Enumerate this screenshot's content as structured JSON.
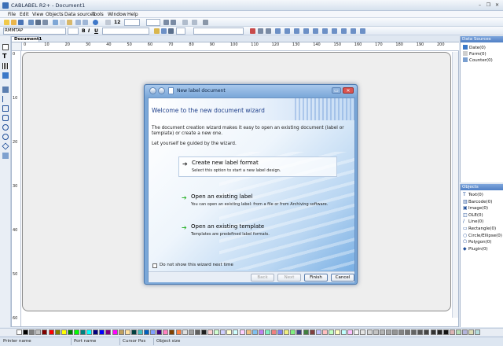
{
  "window": {
    "title": "CABLABEL R2+ - Document1",
    "controls": [
      "–",
      "❐",
      "✕"
    ]
  },
  "menu": [
    "File",
    "Edit",
    "View",
    "Objects",
    "Data sources",
    "Tools",
    "Window",
    "Help"
  ],
  "toolbar": {
    "font_combo": "RMMTAP",
    "size_combo": "12",
    "bold": "B",
    "italic": "I",
    "underline": "U"
  },
  "document": {
    "tab": "Document1"
  },
  "ruler_h": [
    "0",
    "10",
    "20",
    "30",
    "40",
    "50",
    "60",
    "70",
    "80",
    "90",
    "100",
    "110",
    "120",
    "130",
    "140",
    "150",
    "160",
    "170",
    "180",
    "190",
    "200"
  ],
  "ruler_v": [
    "0",
    "10",
    "20",
    "30",
    "40",
    "50",
    "60"
  ],
  "data_sources": {
    "title": "Data Sources",
    "items": [
      {
        "label": "Date(0)",
        "color": "#3a78c8"
      },
      {
        "label": "Form(0)",
        "color": "#cfcfcf"
      },
      {
        "label": "Counter(0)",
        "color": "#7a9fd0"
      }
    ]
  },
  "objects": {
    "title": "Objects",
    "items": [
      {
        "label": "Text(0)",
        "icon": "T"
      },
      {
        "label": "Barcode(0)",
        "icon": "▥"
      },
      {
        "label": "Image(0)",
        "icon": "▣"
      },
      {
        "label": "OLE(0)",
        "icon": "◫"
      },
      {
        "label": "Line(0)",
        "icon": "∕"
      },
      {
        "label": "Rectangle(0)",
        "icon": "▭"
      },
      {
        "label": "Circle/Ellipse(0)",
        "icon": "○"
      },
      {
        "label": "Polygon(0)",
        "icon": "⬠"
      },
      {
        "label": "Plugin(0)",
        "icon": "◆"
      }
    ]
  },
  "dialog": {
    "title": "New label document",
    "heading": "Welcome to the new document wizard",
    "intro_line1": "The document creation wizard makes it easy to open an existing document (label or",
    "intro_line2": "template) or create a new one.",
    "intro_line3": "Let yourself be guided by the wizard.",
    "options": [
      {
        "title": "Create new label format",
        "desc": "Select this option to start a new label design.",
        "arrow": "➔",
        "arrow_color": "#222222"
      },
      {
        "title": "Open an existing label",
        "desc": "You can open an existing label: from a file or from Archiving software.",
        "arrow": "➔",
        "arrow_color": "#2fb42f"
      },
      {
        "title": "Open an existing template",
        "desc": "Templates are predefined label formats.",
        "arrow": "➔",
        "arrow_color": "#2fb42f"
      }
    ],
    "checkbox_label": "Do not show this wizard next time",
    "buttons": {
      "back": "Back",
      "next": "Next",
      "finish": "Finish",
      "cancel": "Cancel"
    }
  },
  "palette": [
    "#ffffff",
    "#000000",
    "#808080",
    "#c0c0c0",
    "#800000",
    "#ff0000",
    "#808000",
    "#ffff00",
    "#008000",
    "#00ff00",
    "#008080",
    "#00ffff",
    "#000080",
    "#0000ff",
    "#800080",
    "#ff00ff",
    "#c0a060",
    "#ffe0a0",
    "#004040",
    "#40c0c0",
    "#0060c0",
    "#80a0ff",
    "#400080",
    "#ff80c0",
    "#804000",
    "#ff8040",
    "#e0e0e0",
    "#a0a0a0",
    "#606060",
    "#202020",
    "#ffd0d0",
    "#d0ffd0",
    "#d0d0ff",
    "#ffffd0",
    "#d0ffff",
    "#ffd0ff",
    "#f0c080",
    "#80c0f0",
    "#c080f0",
    "#80f0c0",
    "#f08080",
    "#8080f0",
    "#f0f080",
    "#80f080",
    "#404080",
    "#408040",
    "#804040",
    "#c0c0ff",
    "#ffc0c0",
    "#c0ffc0",
    "#ffffc0",
    "#c0ffff",
    "#ffc0ff",
    "#f4f4f4",
    "#e4e4e4",
    "#d4d4d4",
    "#c4c4c4",
    "#b4b4b4",
    "#a4a4a4",
    "#949494",
    "#848484",
    "#747474",
    "#646464",
    "#545454",
    "#444444",
    "#343434",
    "#242424",
    "#141414",
    "#dcb4b4",
    "#b4dcb4",
    "#b4b4dc",
    "#dcdcb4",
    "#b4dcdc"
  ],
  "status": {
    "printer": "Printer name",
    "port": "Port name",
    "cursor": "Cursor Pos",
    "objsize": "Object size"
  }
}
